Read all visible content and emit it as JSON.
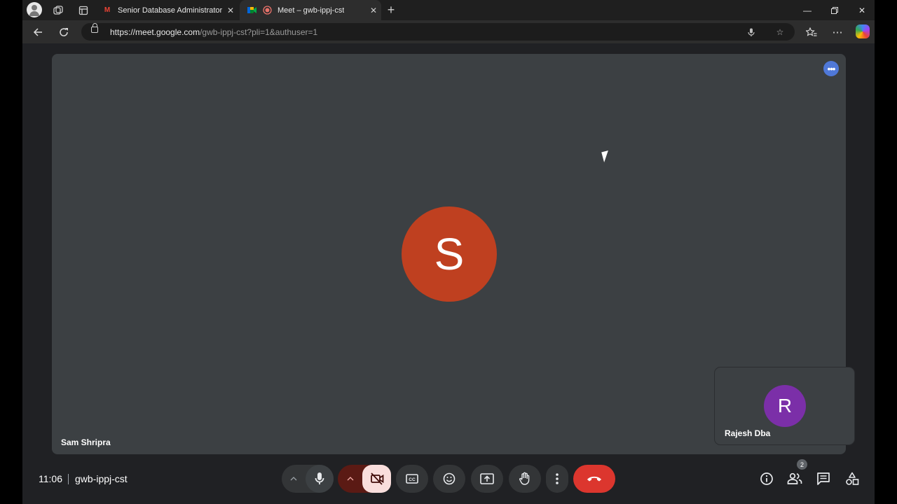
{
  "browser": {
    "tabs": [
      {
        "label": "Senior Database Administrator M",
        "favicon": "gmail-icon"
      },
      {
        "label": "Meet – gwb-ippj-cst",
        "favicon": "meet-icon",
        "active": true
      }
    ],
    "url_host": "https://meet.google.com",
    "url_path": "/gwb-ippj-cst?pli=1&authuser=1"
  },
  "meeting": {
    "main_participant": {
      "initial": "S",
      "name": "Sam Shripra",
      "color": "#bf4020"
    },
    "self_participant": {
      "initial": "R",
      "name": "Rajesh Dba",
      "color": "#7b2fa8"
    },
    "time": "11:06",
    "code": "gwb-ippj-cst",
    "participant_count": "2"
  },
  "controls": {
    "icons": [
      "mic-icon",
      "camera-off-icon",
      "captions-icon",
      "emoji-icon",
      "present-icon",
      "raise-hand-icon",
      "more-options-icon",
      "end-call-icon"
    ],
    "right_icons": [
      "info-icon",
      "people-icon",
      "chat-icon",
      "activities-icon"
    ]
  },
  "colors": {
    "end_call": "#dc362e",
    "camera_off_bg": "#f9dedc",
    "stage_bg": "#3c4043"
  }
}
